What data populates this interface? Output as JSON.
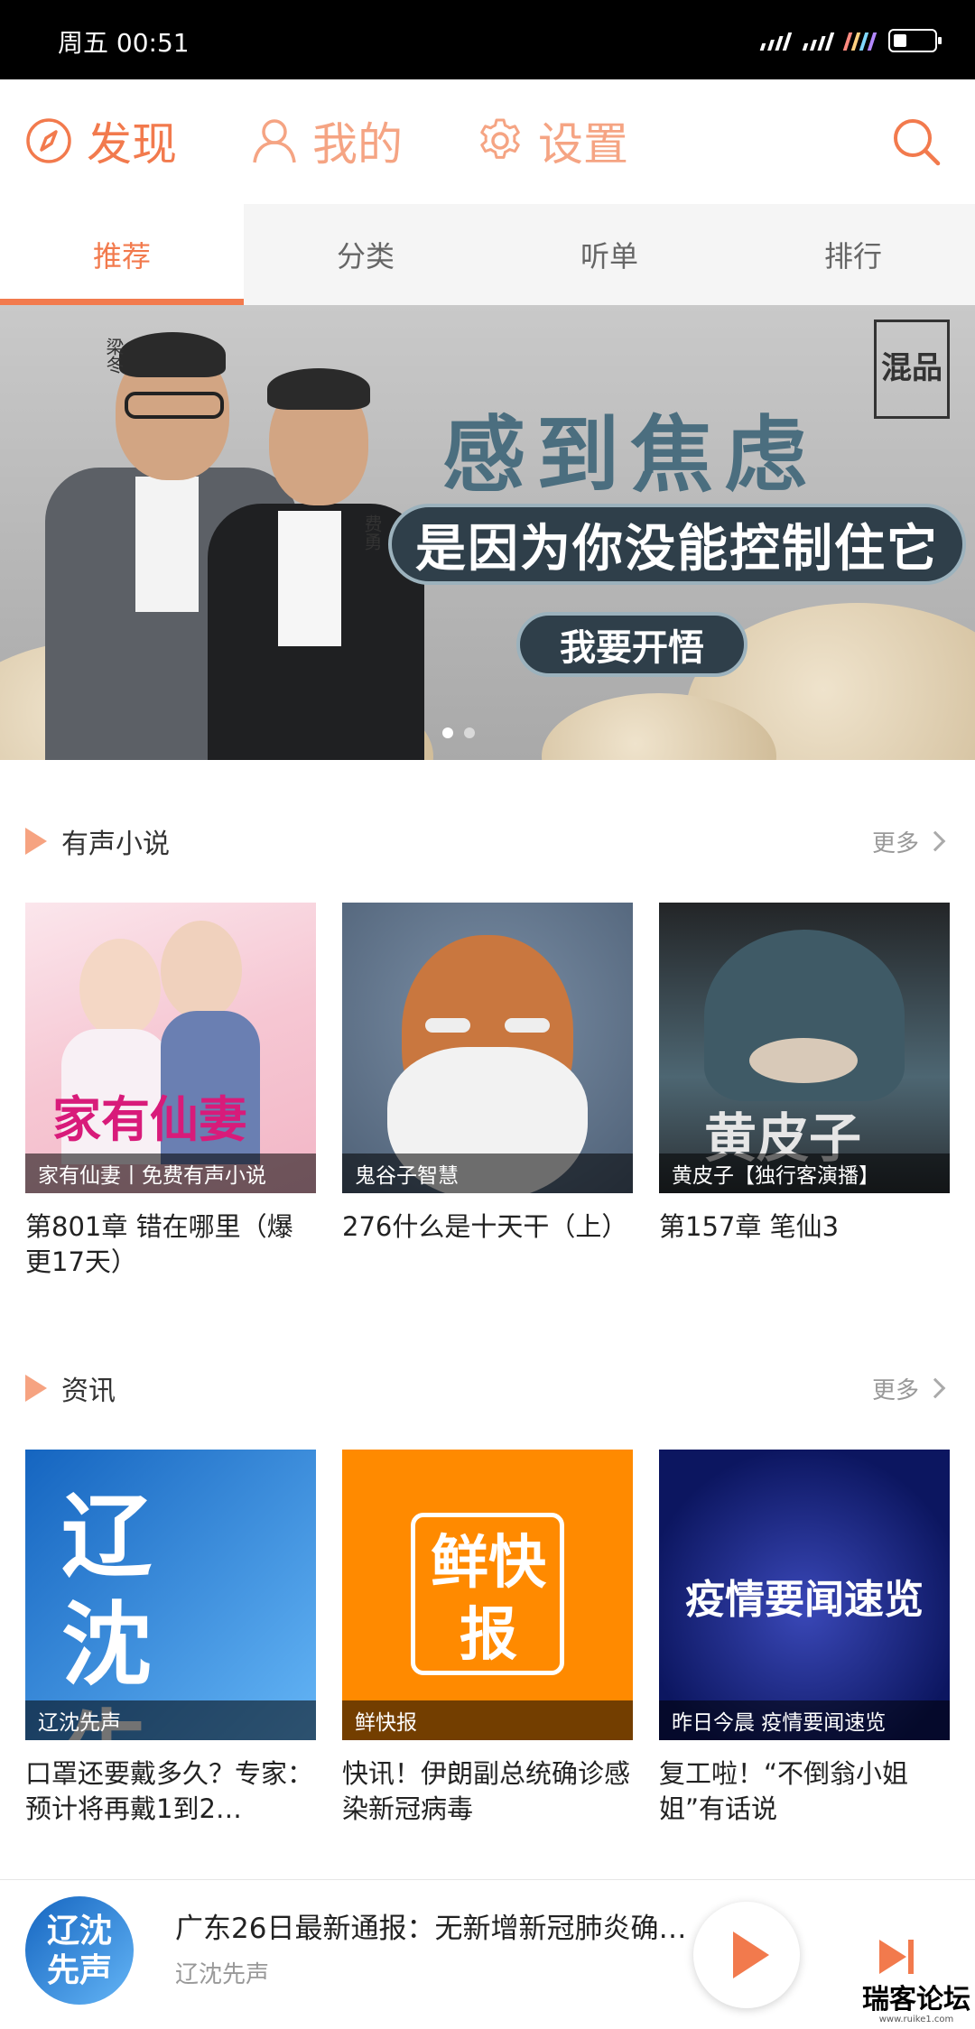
{
  "status_bar": {
    "time": "周五 00:51"
  },
  "nav": {
    "discover": "发现",
    "mine": "我的",
    "settings": "设置"
  },
  "tabs": [
    {
      "label": "推荐",
      "active": true
    },
    {
      "label": "分类",
      "active": false
    },
    {
      "label": "听单",
      "active": false
    },
    {
      "label": "排行",
      "active": false
    }
  ],
  "banner": {
    "title": "感到焦虑",
    "subtitle": "是因为你没能控制住它",
    "button": "我要开悟",
    "host_left": "梁冬",
    "host_right": "费勇",
    "seal": "混品",
    "slide_count": 2,
    "active_slide": 1
  },
  "sections": [
    {
      "title": "有声小说",
      "more": "更多",
      "items": [
        {
          "cover_label": "家有仙妻丨免费有声小说",
          "title": "第801章 错在哪里（爆更17天）",
          "cover_text": "家有仙妻"
        },
        {
          "cover_label": "鬼谷子智慧",
          "title": "276什么是十天干（上）",
          "cover_text": ""
        },
        {
          "cover_label": "黄皮子【独行客演播】",
          "title": "第157章 笔仙3",
          "cover_text": "黄皮子"
        }
      ]
    },
    {
      "title": "资讯",
      "more": "更多",
      "items": [
        {
          "cover_label": "辽沈先声",
          "title": "口罩还要戴多久？专家：预计将再戴1到2…",
          "cover_text": "辽沈先声"
        },
        {
          "cover_label": "鲜快报",
          "title": "快讯！伊朗副总统确诊感染新冠病毒",
          "cover_text": "鲜快报"
        },
        {
          "cover_label": "昨日今晨 疫情要闻速览",
          "title": "复工啦！“不倒翁小姐姐”有话说",
          "cover_text": "疫情要闻速览"
        }
      ]
    }
  ],
  "player": {
    "title": "广东26日最新通报：无新增新冠肺炎确…",
    "subtitle": "辽沈先声",
    "cover_text": "辽沈先声"
  },
  "watermark": {
    "text": "瑞客论坛",
    "url": "www.ruike1.com"
  },
  "colors": {
    "accent": "#f27a4d",
    "accent_light": "#f6a381"
  }
}
